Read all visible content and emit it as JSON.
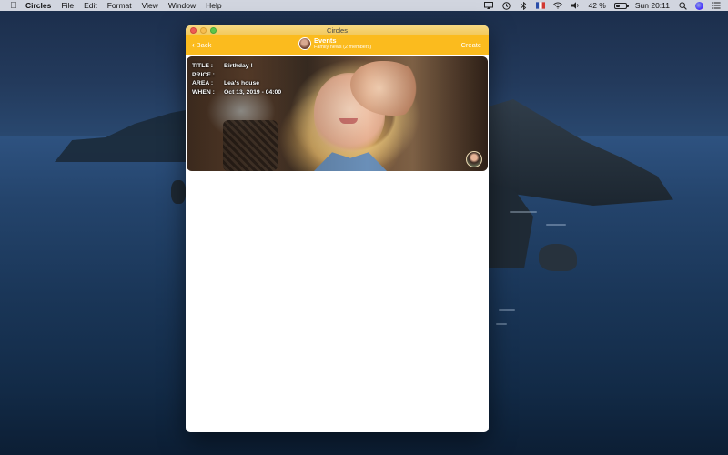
{
  "menubar": {
    "app_name": "Circles",
    "items": [
      "File",
      "Edit",
      "Format",
      "View",
      "Window",
      "Help"
    ],
    "status": {
      "battery_percent_label": "42 %",
      "battery_level": 0.42,
      "clock": "Sun 20:11"
    }
  },
  "window": {
    "title": "Circles",
    "navbar": {
      "back_label": "Back",
      "title": "Events",
      "subtitle": "Family news (2 members)",
      "create_label": "Create"
    },
    "event": {
      "title_label": "TITLE :",
      "title_value": "Birthday !",
      "price_label": "PRICE :",
      "price_value": "",
      "area_label": "AREA :",
      "area_value": "Lea's house",
      "when_label": "WHEN :",
      "when_value": "Oct 13, 2019 - 04:00"
    }
  },
  "colors": {
    "navbar": "#fbbb1e",
    "titlebar": "#f2c85a",
    "window_bg": "#ffffff"
  }
}
